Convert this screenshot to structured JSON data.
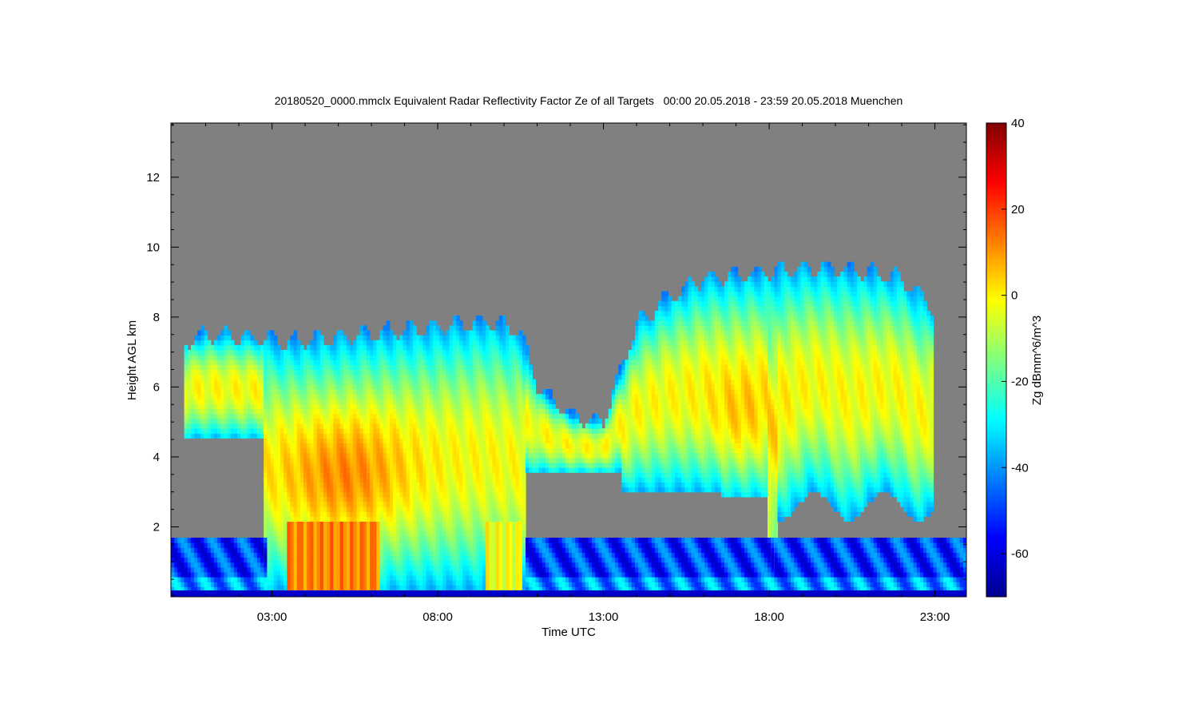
{
  "chart_data": {
    "type": "heatmap",
    "title": "20180520_0000.mmclx Equivalent Radar Reflectivity Factor Ze of all Targets   00:00 20.05.2018 - 23:59 20.05.2018 Muenchen",
    "xlabel": "Time UTC",
    "ylabel": "Height AGL km",
    "colorbar_label": "Zg dBmm^6/m^3",
    "x_ticks": [
      {
        "value": 3,
        "label": "03:00"
      },
      {
        "value": 8,
        "label": "08:00"
      },
      {
        "value": 13,
        "label": "13:00"
      },
      {
        "value": 18,
        "label": "18:00"
      },
      {
        "value": 23,
        "label": "23:00"
      }
    ],
    "y_ticks": [
      {
        "value": 2,
        "label": "2"
      },
      {
        "value": 4,
        "label": "4"
      },
      {
        "value": 6,
        "label": "6"
      },
      {
        "value": 8,
        "label": "8"
      },
      {
        "value": 10,
        "label": "10"
      },
      {
        "value": 12,
        "label": "12"
      }
    ],
    "colorbar_ticks": [
      {
        "value": 40,
        "label": "40"
      },
      {
        "value": 20,
        "label": "20"
      },
      {
        "value": 0,
        "label": "0"
      },
      {
        "value": -20,
        "label": "-20"
      },
      {
        "value": -40,
        "label": "-40"
      },
      {
        "value": -60,
        "label": "-60"
      }
    ],
    "xlim": [
      -0.05,
      23.95
    ],
    "ylim": [
      0.0,
      13.55
    ],
    "zlim": [
      -70,
      40
    ],
    "colormap": "jet",
    "no_signal_color": "#808080",
    "cloud_top_profile": [
      [
        0.3,
        7.3
      ],
      [
        1.0,
        7.5
      ],
      [
        2.5,
        7.4
      ],
      [
        3.5,
        7.3
      ],
      [
        5.0,
        7.4
      ],
      [
        6.5,
        7.6
      ],
      [
        8.0,
        7.7
      ],
      [
        9.5,
        7.9
      ],
      [
        10.5,
        7.6
      ],
      [
        11.0,
        6.0
      ],
      [
        12.0,
        5.2
      ],
      [
        13.0,
        5.0
      ],
      [
        14.0,
        7.8
      ],
      [
        15.0,
        8.6
      ],
      [
        16.0,
        9.1
      ],
      [
        17.0,
        9.2
      ],
      [
        18.0,
        9.3
      ],
      [
        19.0,
        9.4
      ],
      [
        20.0,
        9.4
      ],
      [
        21.0,
        9.3
      ],
      [
        22.0,
        9.1
      ],
      [
        23.0,
        8.2
      ]
    ],
    "precip_columns": [
      {
        "t_start": 3.5,
        "t_end": 6.2,
        "max_dbz": 20
      },
      {
        "t_start": 9.4,
        "t_end": 10.5,
        "max_dbz": 5
      },
      {
        "t_start": 17.9,
        "t_end": 18.2,
        "max_dbz": -5
      }
    ],
    "grid": false
  }
}
